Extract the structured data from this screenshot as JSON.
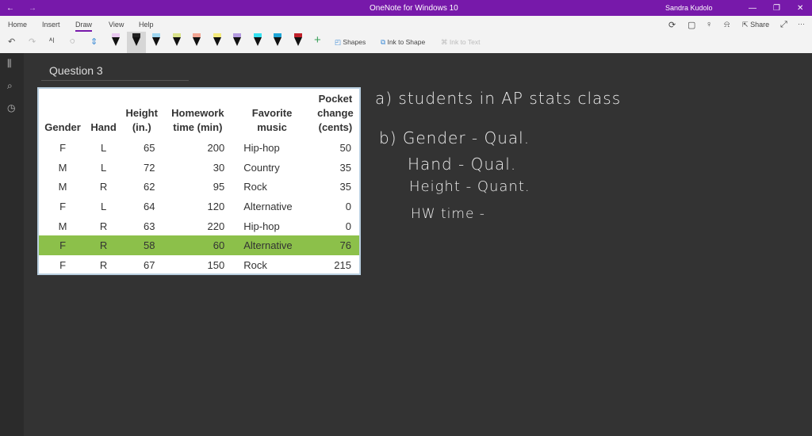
{
  "titlebar": {
    "back": "←",
    "forward": "→",
    "title": "OneNote for Windows 10",
    "user": "Sandra Kudolo",
    "minimize": "—",
    "restore": "❐",
    "close": "✕"
  },
  "ribbon": {
    "tabs": [
      "Home",
      "Insert",
      "Draw",
      "View",
      "Help"
    ],
    "active_tab": "Draw",
    "undo": "↶",
    "redo": "↷",
    "add_pen": "+",
    "shapes": "Shapes",
    "ink_to_shape": "Ink to Shape",
    "ink_to_text": "Ink to Text",
    "share": "Share",
    "more": "···",
    "pen_colors": [
      "#e8c8ef",
      "#222222",
      "#9fd6f0",
      "#d9e28a",
      "#f2a593",
      "#f4ea7c",
      "#b49ae0",
      "#35e1f0",
      "#1fa5d6",
      "#c0202a"
    ]
  },
  "sidebar": {
    "notebooks": "⫼",
    "search": "⌕",
    "recent": "◷"
  },
  "page": {
    "title": "Question 3"
  },
  "table": {
    "headers": [
      "Gender",
      "Hand",
      "Height\n(in.)",
      "Homework\ntime (min)",
      "Favorite\nmusic",
      "Pocket\nchange\n(cents)"
    ],
    "rows": [
      [
        "F",
        "L",
        "65",
        "200",
        "Hip-hop",
        "50"
      ],
      [
        "M",
        "L",
        "72",
        "30",
        "Country",
        "35"
      ],
      [
        "M",
        "R",
        "62",
        "95",
        "Rock",
        "35"
      ],
      [
        "F",
        "L",
        "64",
        "120",
        "Alternative",
        "0"
      ],
      [
        "M",
        "R",
        "63",
        "220",
        "Hip-hop",
        "0"
      ],
      [
        "F",
        "R",
        "58",
        "60",
        "Alternative",
        "76"
      ],
      [
        "F",
        "R",
        "67",
        "150",
        "Rock",
        "215"
      ]
    ],
    "highlight_color": "#8cc04a"
  },
  "notes": {
    "a": "a) students in AP stats class",
    "b1": "b) Gender - Qual.",
    "b2": "Hand - Qual.",
    "b3": "Height - Quant.",
    "b4": "HW time -"
  }
}
